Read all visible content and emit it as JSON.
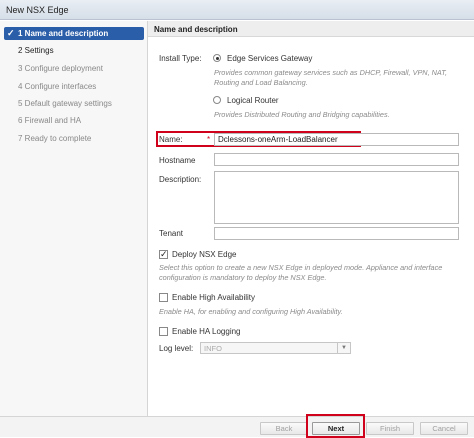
{
  "window": {
    "title": "New NSX Edge"
  },
  "steps": [
    {
      "label": "1  Name and description",
      "state": "active"
    },
    {
      "label": "2  Settings",
      "state": "done"
    },
    {
      "label": "3  Configure deployment",
      "state": "pending"
    },
    {
      "label": "4  Configure interfaces",
      "state": "pending"
    },
    {
      "label": "5  Default gateway settings",
      "state": "pending"
    },
    {
      "label": "6  Firewall and HA",
      "state": "pending"
    },
    {
      "label": "7  Ready to complete",
      "state": "pending"
    }
  ],
  "step_check": "✓",
  "section": {
    "title": "Name and description"
  },
  "install_type": {
    "label": "Install Type:",
    "options": [
      {
        "label": "Edge Services Gateway",
        "selected": true,
        "help": "Provides common gateway services such as DHCP, Firewall, VPN, NAT, Routing and Load Balancing."
      },
      {
        "label": "Logical Router",
        "selected": false,
        "help": "Provides Distributed Routing and Bridging  capabilities."
      }
    ]
  },
  "name": {
    "label": "Name:",
    "required_mark": "*",
    "value": "Dclessons-oneArm-LoadBalancer"
  },
  "hostname": {
    "label": "Hostname",
    "value": ""
  },
  "description": {
    "label": "Description:",
    "value": ""
  },
  "tenant": {
    "label": "Tenant",
    "value": ""
  },
  "deploy": {
    "label": "Deploy NSX Edge",
    "checked": true,
    "help": "Select this option to create a new NSX Edge in deployed mode. Appliance and interface configuration is mandatory to deploy the NSX Edge."
  },
  "ha": {
    "label": "Enable High Availability",
    "checked": false,
    "help": "Enable HA, for enabling and configuring High Availability."
  },
  "ha_logging": {
    "label": "Enable HA Logging",
    "checked": false
  },
  "log_level": {
    "label": "Log level:",
    "value": "INFO"
  },
  "buttons": {
    "back": "Back",
    "next": "Next",
    "finish": "Finish",
    "cancel": "Cancel"
  },
  "accent_color": "#2b5ea8",
  "highlight_color": "#d0021b"
}
